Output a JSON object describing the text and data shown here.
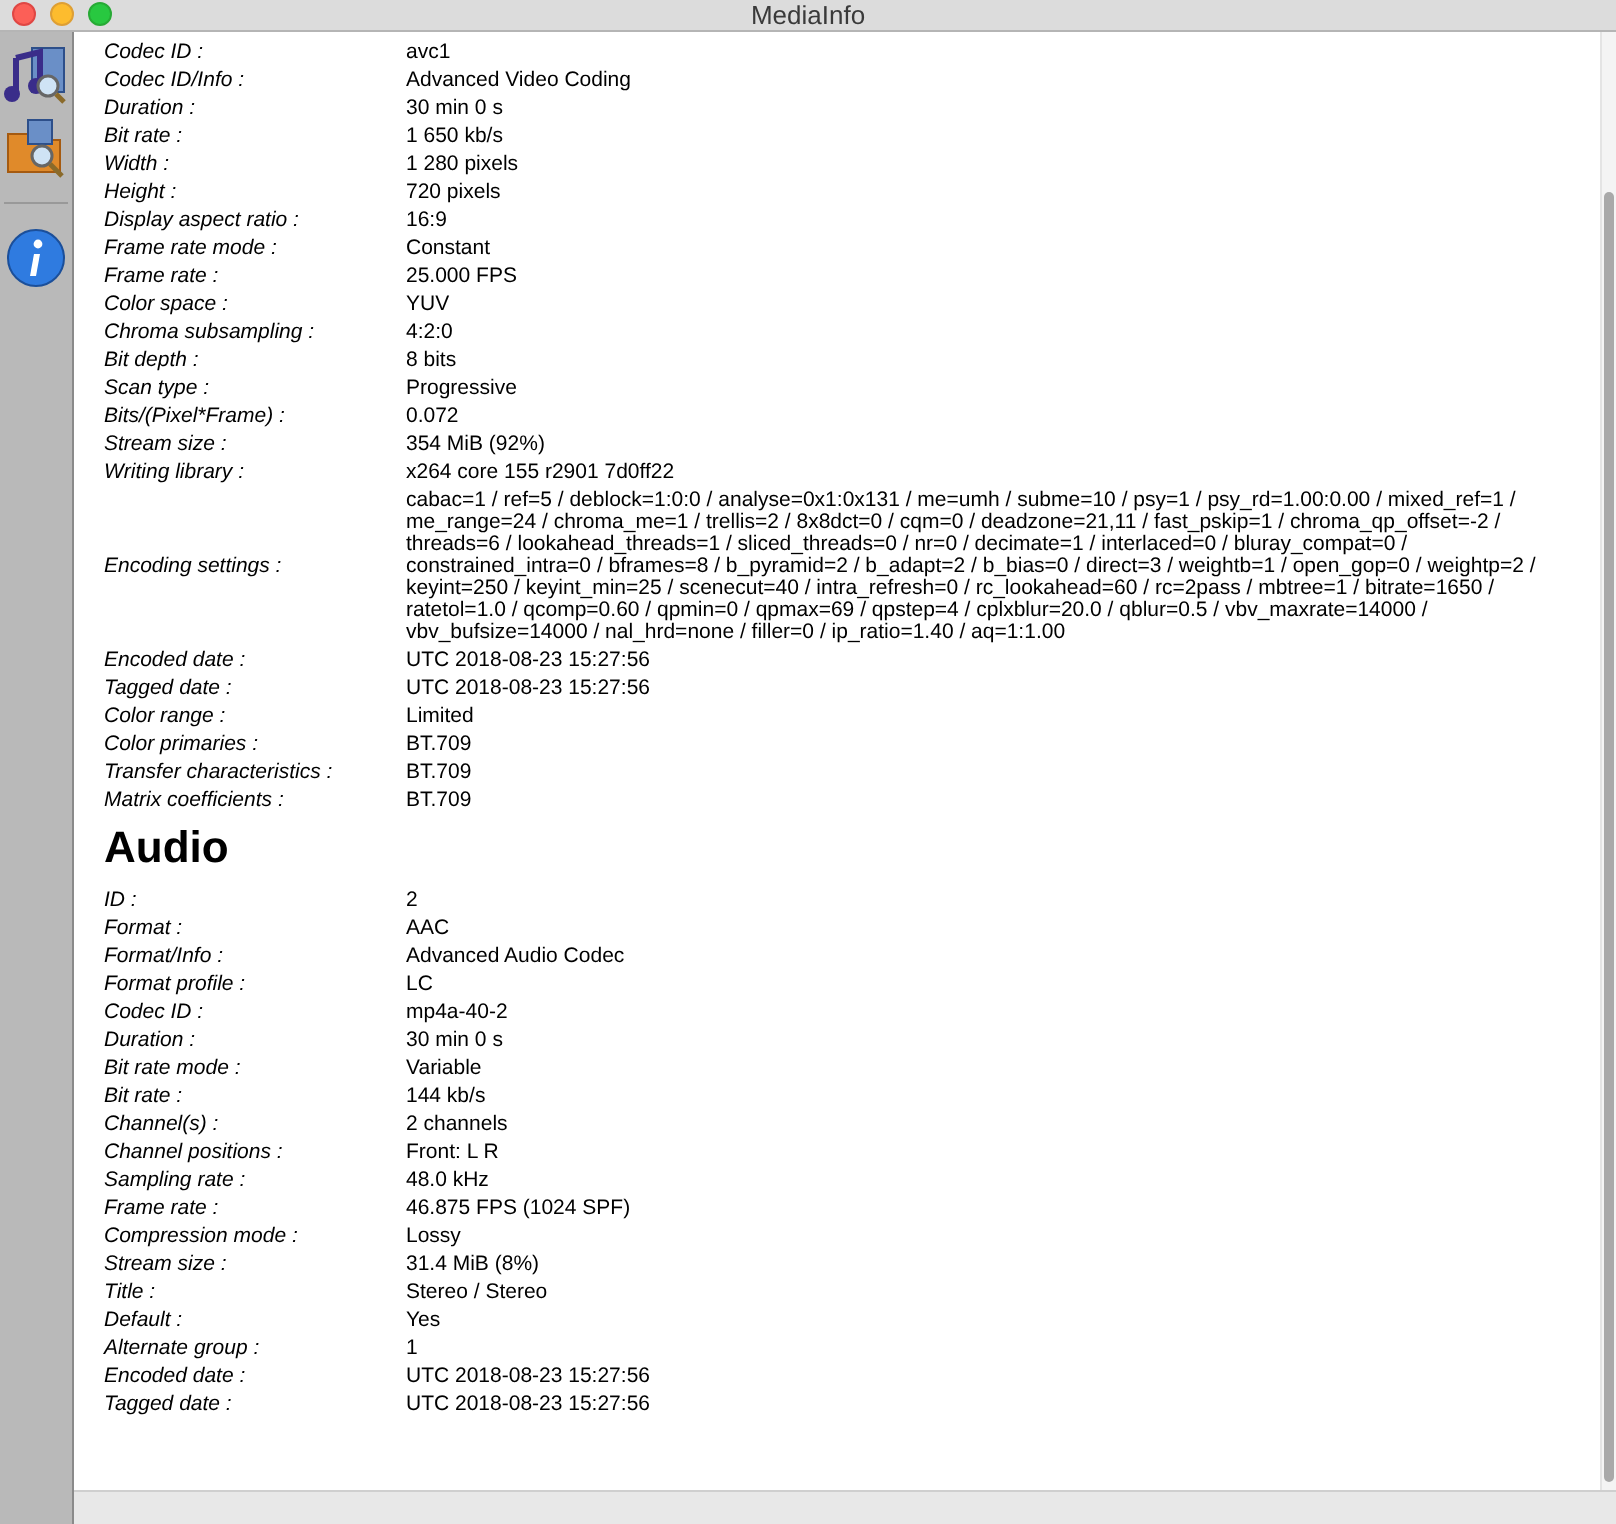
{
  "window": {
    "title": "MediaInfo"
  },
  "video_fields": [
    {
      "label": "Codec ID :",
      "value": "avc1"
    },
    {
      "label": "Codec ID/Info :",
      "value": "Advanced Video Coding"
    },
    {
      "label": "Duration :",
      "value": "30 min 0 s"
    },
    {
      "label": "Bit rate :",
      "value": "1 650 kb/s"
    },
    {
      "label": "Width :",
      "value": "1 280 pixels"
    },
    {
      "label": "Height :",
      "value": "720 pixels"
    },
    {
      "label": "Display aspect ratio :",
      "value": "16:9"
    },
    {
      "label": "Frame rate mode :",
      "value": "Constant"
    },
    {
      "label": "Frame rate :",
      "value": "25.000 FPS"
    },
    {
      "label": "Color space :",
      "value": "YUV"
    },
    {
      "label": "Chroma subsampling :",
      "value": "4:2:0"
    },
    {
      "label": "Bit depth :",
      "value": "8 bits"
    },
    {
      "label": "Scan type :",
      "value": "Progressive"
    },
    {
      "label": "Bits/(Pixel*Frame) :",
      "value": "0.072"
    },
    {
      "label": "Stream size :",
      "value": "354 MiB (92%)"
    },
    {
      "label": "Writing library :",
      "value": "x264 core 155 r2901 7d0ff22"
    },
    {
      "label": "Encoding settings :",
      "value": "cabac=1 / ref=5 / deblock=1:0:0 / analyse=0x1:0x131 / me=umh / subme=10 / psy=1 / psy_rd=1.00:0.00 / mixed_ref=1 / me_range=24 / chroma_me=1 / trellis=2 / 8x8dct=0 / cqm=0 / deadzone=21,11 / fast_pskip=1 / chroma_qp_offset=-2 / threads=6 / lookahead_threads=1 / sliced_threads=0 / nr=0 / decimate=1 / interlaced=0 / bluray_compat=0 / constrained_intra=0 / bframes=8 / b_pyramid=2 / b_adapt=2 / b_bias=0 / direct=3 / weightb=1 / open_gop=0 / weightp=2 / keyint=250 / keyint_min=25 / scenecut=40 / intra_refresh=0 / rc_lookahead=60 / rc=2pass / mbtree=1 / bitrate=1650 / ratetol=1.0 / qcomp=0.60 / qpmin=0 / qpmax=69 / qpstep=4 / cplxblur=20.0 / qblur=0.5 / vbv_maxrate=14000 / vbv_bufsize=14000 / nal_hrd=none / filler=0 / ip_ratio=1.40 / aq=1:1.00"
    },
    {
      "label": "Encoded date :",
      "value": "UTC 2018-08-23 15:27:56"
    },
    {
      "label": "Tagged date :",
      "value": "UTC 2018-08-23 15:27:56"
    },
    {
      "label": "Color range :",
      "value": "Limited"
    },
    {
      "label": "Color primaries :",
      "value": "BT.709"
    },
    {
      "label": "Transfer characteristics :",
      "value": "BT.709"
    },
    {
      "label": "Matrix coefficients :",
      "value": "BT.709"
    }
  ],
  "audio": {
    "heading": "Audio",
    "fields": [
      {
        "label": "ID :",
        "value": "2"
      },
      {
        "label": "Format :",
        "value": "AAC"
      },
      {
        "label": "Format/Info :",
        "value": "Advanced Audio Codec"
      },
      {
        "label": "Format profile :",
        "value": "LC"
      },
      {
        "label": "Codec ID :",
        "value": "mp4a-40-2"
      },
      {
        "label": "Duration :",
        "value": "30 min 0 s"
      },
      {
        "label": "Bit rate mode :",
        "value": "Variable"
      },
      {
        "label": "Bit rate :",
        "value": "144 kb/s"
      },
      {
        "label": "Channel(s) :",
        "value": "2 channels"
      },
      {
        "label": "Channel positions :",
        "value": "Front: L R"
      },
      {
        "label": "Sampling rate :",
        "value": "48.0 kHz"
      },
      {
        "label": "Frame rate :",
        "value": "46.875 FPS (1024 SPF)"
      },
      {
        "label": "Compression mode :",
        "value": "Lossy"
      },
      {
        "label": "Stream size :",
        "value": "31.4 MiB (8%)"
      },
      {
        "label": "Title :",
        "value": "Stereo / Stereo"
      },
      {
        "label": "Default :",
        "value": "Yes"
      },
      {
        "label": "Alternate group :",
        "value": "1"
      },
      {
        "label": "Encoded date :",
        "value": "UTC 2018-08-23 15:27:56"
      },
      {
        "label": "Tagged date :",
        "value": "UTC 2018-08-23 15:27:56"
      }
    ]
  }
}
